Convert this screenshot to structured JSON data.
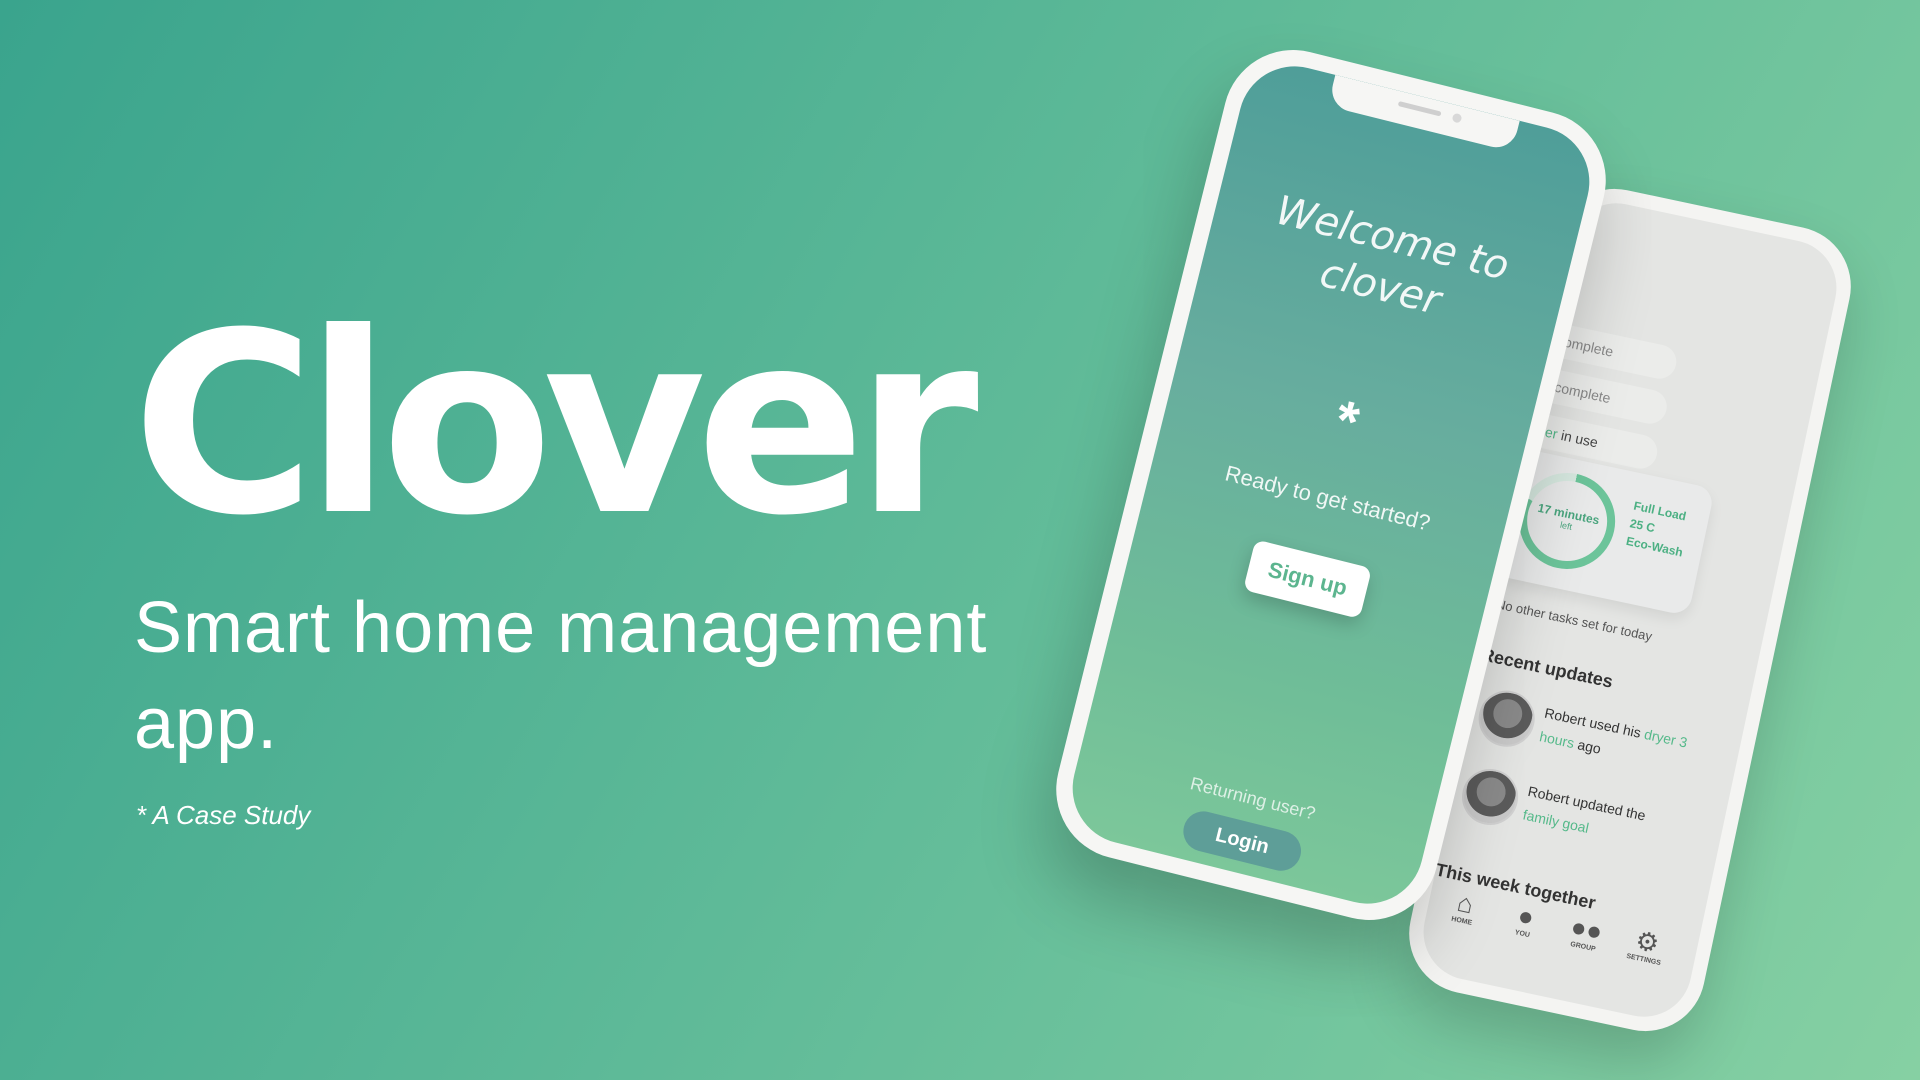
{
  "hero": {
    "title": "Clover",
    "subtitle": "Smart home management app.",
    "note": "* A Case Study"
  },
  "front_phone": {
    "welcome": "Welcome to clover",
    "asterisk": "*",
    "prompt": "Ready to get started?",
    "signup_label": "Sign up",
    "returning_label": "Returning user?",
    "login_label": "Login"
  },
  "back_phone": {
    "tasks": [
      {
        "text": "omplete"
      },
      {
        "text": "complete"
      },
      {
        "accent": "er",
        "text": " in use"
      }
    ],
    "wash": {
      "time_main": "17 minutes",
      "time_sub": "left",
      "line1": "Full Load",
      "line2": "25 C",
      "line3": "Eco-Wash",
      "progress": 0.8
    },
    "no_tasks": "No other tasks set for today",
    "recent_heading": "Recent updates",
    "updates": [
      {
        "pre": "Robert used his ",
        "accent": "dryer 3 hours",
        "post": " ago"
      },
      {
        "pre": "Robert updated the ",
        "accent": "family goal",
        "post": ""
      }
    ],
    "week_heading": "This week together",
    "tabs": [
      {
        "label": "HOME",
        "icon": "home-icon"
      },
      {
        "label": "YOU",
        "icon": "user-icon"
      },
      {
        "label": "GROUP",
        "icon": "group-icon"
      },
      {
        "label": "SETTINGS",
        "icon": "gear-icon"
      }
    ]
  },
  "colors": {
    "background_start": "#3aa48d",
    "background_end": "#86d0a3",
    "accent": "#55b98a"
  }
}
